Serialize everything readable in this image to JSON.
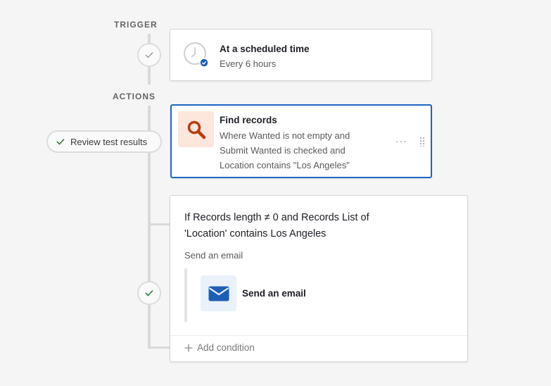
{
  "sections": {
    "trigger_label": "TRIGGER",
    "actions_label": "ACTIONS"
  },
  "trigger_card": {
    "title": "At a scheduled time",
    "subtitle": "Every 6 hours",
    "icon": "clock-icon"
  },
  "review_button": {
    "label": "Review test results",
    "icon": "check-icon"
  },
  "find_records_card": {
    "title": "Find records",
    "line1": "Where Wanted is not empty and",
    "line2": "Submit Wanted is checked and",
    "line3": "Location contains \"Los Angeles\"",
    "icon": "magnifier-icon",
    "menu": "···",
    "icon_color": "#b83c0c",
    "icon_bg": "#fde6dc"
  },
  "condition_card": {
    "title_line1": "If Records length ≠ 0 and Records List of",
    "title_line2": "'Location' contains Los Angeles",
    "group_label": "Send an email",
    "action_label": "Send an email",
    "action_icon": "envelope-icon",
    "add_condition": "Add condition",
    "add_icon": "plus-icon"
  },
  "colors": {
    "accent": "#1d66c2",
    "success": "#2f7d32"
  }
}
